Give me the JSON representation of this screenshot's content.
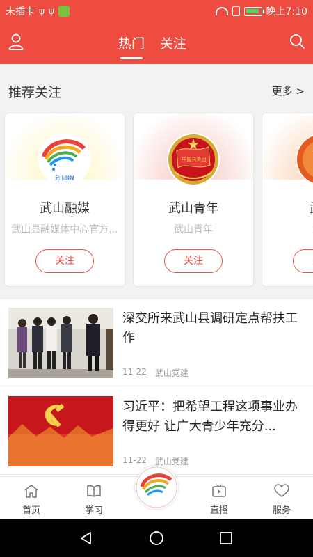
{
  "status": {
    "carrier": "未插卡",
    "usb1": "ψ",
    "usb2": "ψ",
    "time": "晚上7:10"
  },
  "header": {
    "tabs": [
      {
        "label": "热门",
        "active": true
      },
      {
        "label": "关注",
        "active": false
      }
    ]
  },
  "recommend": {
    "title": "推荐关注",
    "more": "更多 >",
    "cards": [
      {
        "name": "武山融媒",
        "desc": "武山县融媒体中心官方...",
        "follow": "关注",
        "logo_text": "武山融媒"
      },
      {
        "name": "武山青年",
        "desc": "武山青年",
        "follow": "关注",
        "logo_text": "中国共青团"
      },
      {
        "name": "武山",
        "desc": "武山",
        "follow": "关注"
      }
    ]
  },
  "news": [
    {
      "title": "深交所来武山县调研定点帮扶工作",
      "date": "11-22",
      "source": "武山党建"
    },
    {
      "title": "习近平：把希望工程这项事业办得更好 让广大青少年充分...",
      "date": "11-22",
      "source": "武山党建"
    }
  ],
  "bottom_nav": [
    {
      "label": "首页",
      "icon": "home-icon"
    },
    {
      "label": "学习",
      "icon": "book-icon"
    },
    {
      "label": "直播",
      "icon": "tv-icon"
    },
    {
      "label": "服务",
      "icon": "heart-icon"
    }
  ],
  "colors": {
    "accent": "#ee4b41"
  }
}
